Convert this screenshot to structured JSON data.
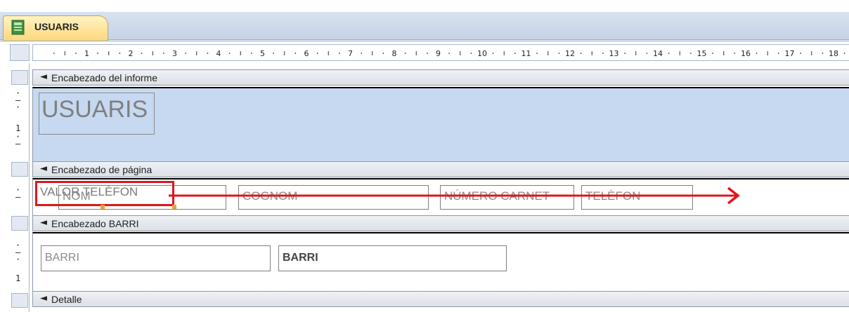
{
  "tab": {
    "label": "USUARIS",
    "icon": "report-icon"
  },
  "ruler": {
    "numbers": [
      "1",
      "2",
      "3",
      "4",
      "5",
      "6",
      "7",
      "8",
      "9",
      "10",
      "11",
      "12",
      "13",
      "14",
      "15",
      "16",
      "17",
      "18"
    ]
  },
  "sections": {
    "report_header": "Encabezado del informe",
    "page_header": "Encabezado de página",
    "group_header": "Encabezado BARRI",
    "detail": "Detalle"
  },
  "controls": {
    "title": "USUARIS",
    "nom": "NOM",
    "cognom": "COGNOM",
    "numero_carnet": "NÚMERO CARNET",
    "telefon": "TELÈFON",
    "valor_telefon": "VALOR TELÈFON",
    "barri_label": "BARRI",
    "barri_field": "BARRI"
  },
  "vruler": {
    "mark_one": "1"
  },
  "colors": {
    "highlight": "#e0151b",
    "header_band": "#c6d9f0"
  }
}
